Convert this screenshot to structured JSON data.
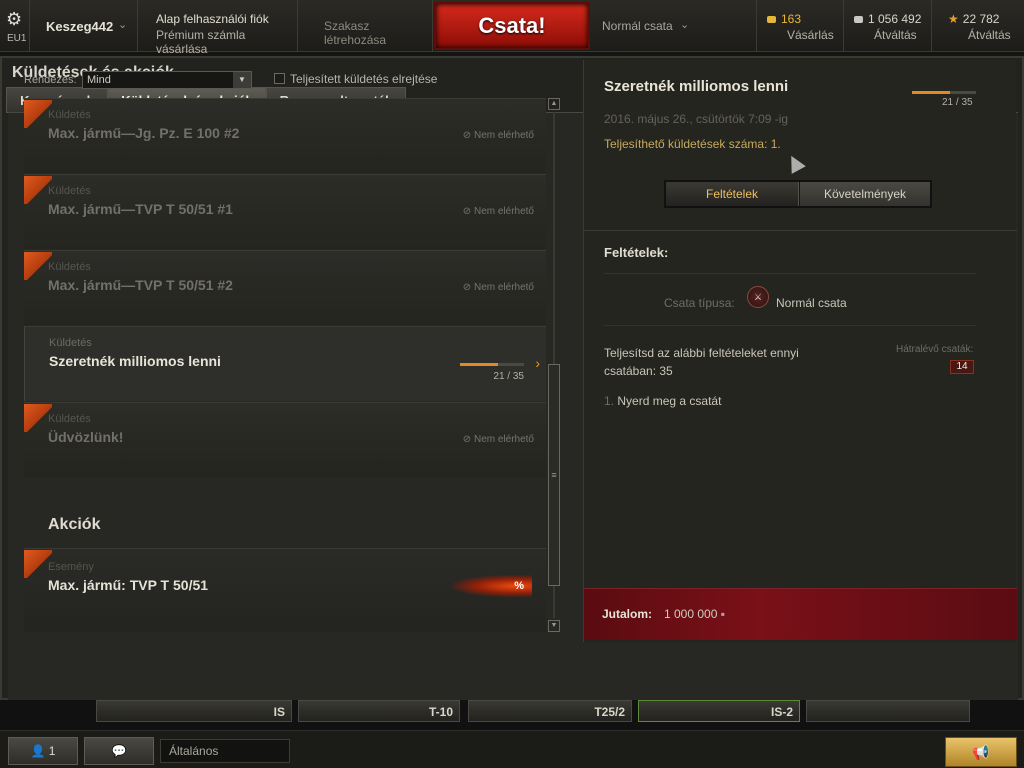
{
  "topbar": {
    "server": "EU1",
    "username": "Keszeg442",
    "account_type": "Alap felhasználói fiók",
    "premium_link": "Prémium számla vásárlása",
    "platoon": "Szakasz létrehozása",
    "battle_button": "Csata!",
    "battle_mode": "Normál csata",
    "gold_value": "163",
    "gold_label": "Vásárlás",
    "credits_value": "1 056 492",
    "credits_label": "Átváltás",
    "xp_value": "22 782",
    "xp_label": "Átváltás",
    "colors": {
      "gold": "#e6b63a",
      "credits": "#c8c8c8",
      "xp": "#e6a030"
    }
  },
  "window": {
    "title": "Küldetések és akciók",
    "tabs": [
      {
        "label": "Kampányok"
      },
      {
        "label": "Küldetések és akciók"
      },
      {
        "label": "Rangsorolt csaták"
      }
    ]
  },
  "left": {
    "sort_label": "Rendezés:",
    "sort_value": "Mind",
    "hide_completed_label": "Teljesített küldetés elrejtése",
    "quests": [
      {
        "type": "Küldetés",
        "name": "Max. jármű—Jg. Pz. E 100 #2",
        "status": "Nem elérhető"
      },
      {
        "type": "Küldetés",
        "name": "Max. jármű—TVP T 50/51 #1",
        "status": "Nem elérhető"
      },
      {
        "type": "Küldetés",
        "name": "Max. jármű—TVP T 50/51 #2",
        "status": "Nem elérhető"
      },
      {
        "type": "Küldetés",
        "name": "Szeretnék milliomos lenni",
        "progress_text": "21 / 35",
        "progress": 0.6
      },
      {
        "type": "Küldetés",
        "name": "Üdvözlünk!",
        "status": "Nem elérhető"
      }
    ],
    "actions_heading": "Akciók",
    "event": {
      "type": "Esemény",
      "name": "Max. jármű: TVP T 50/51",
      "badge": "%"
    }
  },
  "right": {
    "title": "Szeretnék milliomos lenni",
    "date": "2016. május 26., csütörtök 7:09 -ig",
    "available_count": "Teljesíthető küldetések száma: 1.",
    "progress_text": "21 / 35",
    "progress": 0.6,
    "tab_conditions": "Feltételek",
    "tab_requirements": "Követelmények",
    "conditions_heading": "Feltételek:",
    "battle_type_label": "Csata típusa:",
    "battle_type_value": "Normál csata",
    "complete_text": "Teljesítsd az alábbi feltételeket ennyi csatában: 35",
    "remaining_label": "Hátralévő csaták:",
    "remaining_value": "14",
    "condition_num": "1.",
    "condition_text": "Nyerd meg a csatát",
    "reward_label": "Jutalom:",
    "reward_value": "1 000 000"
  },
  "hangar": {
    "tanks": [
      "IS",
      "T-10",
      "T25/2",
      "IS-2"
    ]
  },
  "bottombar": {
    "friends_count": "1",
    "chat_channel": "Általános"
  }
}
